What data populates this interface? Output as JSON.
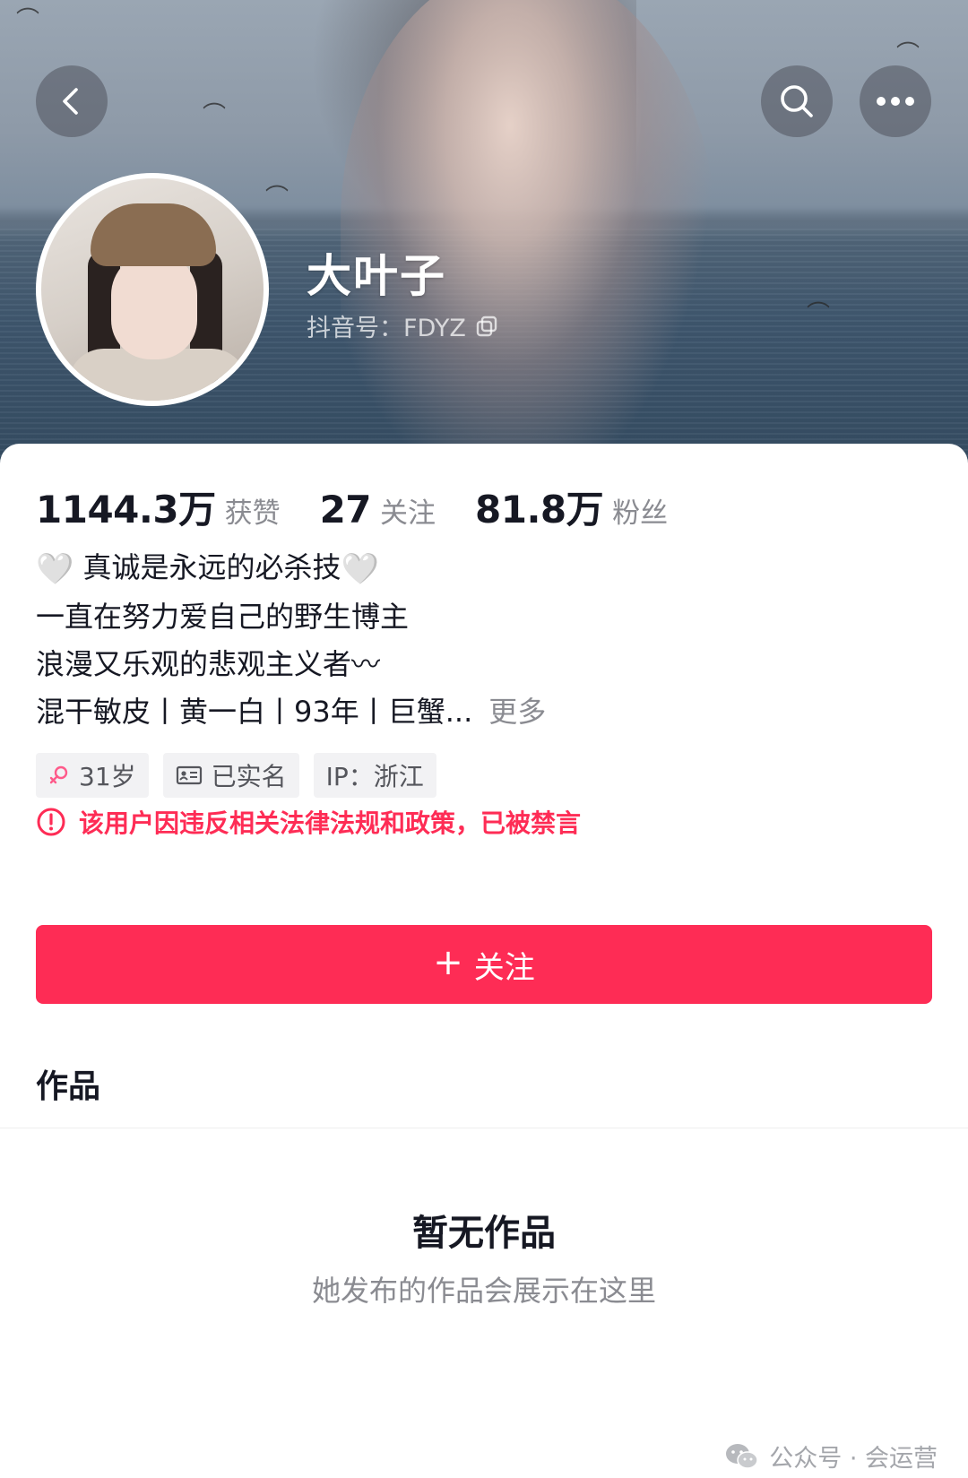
{
  "header": {
    "back_icon": "chevron-left-icon",
    "search_icon": "search-icon",
    "more_icon": "more-dots-icon"
  },
  "profile": {
    "nickname": "大叶子",
    "douyin_id": "抖音号：FDYZ",
    "copy_icon": "copy-icon"
  },
  "stats": [
    {
      "value": "1144.3万",
      "label": "获赞"
    },
    {
      "value": "27",
      "label": "关注"
    },
    {
      "value": "81.8万",
      "label": "粉丝"
    }
  ],
  "bio": {
    "line1_left_emoji": "🤍",
    "line1_text": " 真诚是永远的必杀技",
    "line1_right_emoji": "🤍",
    "line2": "一直在努力爱自己的野生博主",
    "line3": "浪漫又乐观的悲观主义者〰",
    "line4": "混干敏皮丨黄一白丨93年丨巨蟹...",
    "more": "更多"
  },
  "tags": [
    {
      "icon": "female-icon",
      "label": "31岁"
    },
    {
      "icon": "id-card-icon",
      "label": "已实名"
    },
    {
      "icon": "",
      "label": "IP：浙江"
    }
  ],
  "notice": {
    "icon": "warning-circle-icon",
    "text": "该用户因违反相关法律法规和政策，已被禁言"
  },
  "follow_button": {
    "plus": "+",
    "label": "关注"
  },
  "works_tab": "作品",
  "empty_state": {
    "title": "暂无作品",
    "subtitle": "她发布的作品会展示在这里"
  },
  "watermark": {
    "icon": "wechat-icon",
    "text": "公众号 · 会运营"
  },
  "colors": {
    "accent": "#fe2c55",
    "text_primary": "#161823",
    "text_secondary": "#8a8b91",
    "tag_bg": "#f2f2f4"
  }
}
